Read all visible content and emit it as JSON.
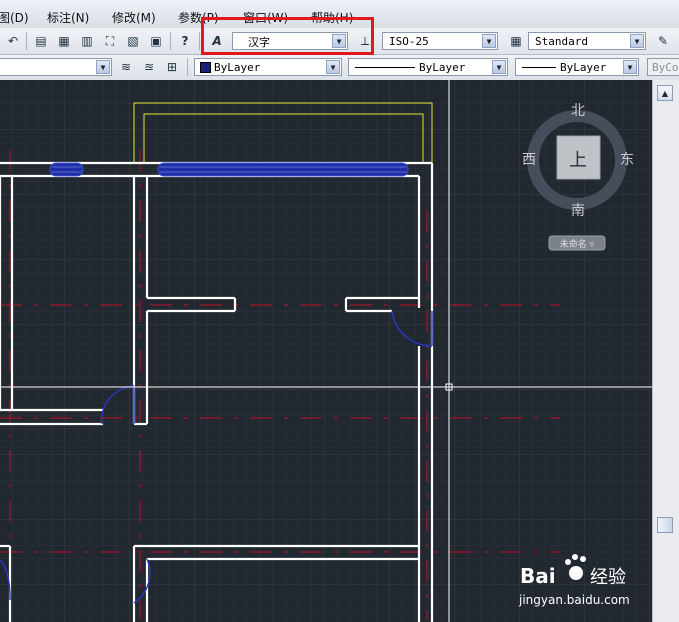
{
  "menu": {
    "items": [
      "图(D)",
      "标注(N)",
      "修改(M)",
      "参数(P)",
      "窗口(W)",
      "帮助(H)"
    ]
  },
  "toolbar_styles": {
    "text_style": "汉字",
    "dim_style": "ISO-25",
    "table_style": "Standard"
  },
  "toolbar_props": {
    "color": "ByLayer",
    "linetype": "ByLayer",
    "lineweight": "ByLayer",
    "plotstyle": "ByCo"
  },
  "viewcube": {
    "north": "北",
    "south": "南",
    "west": "西",
    "east": "东",
    "face": "上",
    "ucs": "未命名 ▿"
  },
  "watermark": {
    "brand": "Bai",
    "brand2": "经验",
    "url": "jingyan.baidu.com"
  },
  "colors": {
    "canvas_bg": "#212830",
    "highlight_box": "#e01919",
    "wall": "#ffffff",
    "window": "#1a2db8",
    "axis": "#c0102a"
  }
}
